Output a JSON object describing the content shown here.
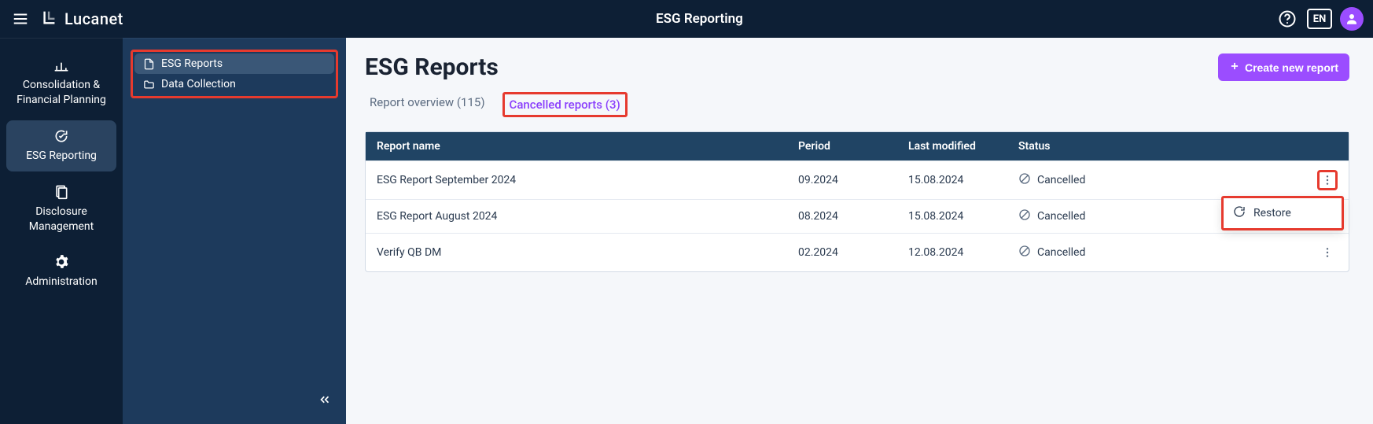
{
  "header": {
    "brand": "Lucanet",
    "title": "ESG Reporting",
    "lang": "EN"
  },
  "nav": {
    "items": [
      {
        "label": "Consolidation & Financial Planning"
      },
      {
        "label": "ESG Reporting"
      },
      {
        "label": "Disclosure Management"
      },
      {
        "label": "Administration"
      }
    ]
  },
  "sidebar": {
    "items": [
      {
        "label": "ESG Reports"
      },
      {
        "label": "Data Collection"
      }
    ]
  },
  "page": {
    "title": "ESG Reports",
    "create_label": "Create new report"
  },
  "tabs": {
    "overview": "Report overview (115)",
    "cancelled": "Cancelled reports (3)"
  },
  "table": {
    "headers": {
      "name": "Report name",
      "period": "Period",
      "modified": "Last modified",
      "status": "Status"
    },
    "rows": [
      {
        "name": "ESG Report September 2024",
        "period": "09.2024",
        "modified": "15.08.2024",
        "status": "Cancelled"
      },
      {
        "name": "ESG Report August 2024",
        "period": "08.2024",
        "modified": "15.08.2024",
        "status": "Cancelled"
      },
      {
        "name": "Verify QB DM",
        "period": "02.2024",
        "modified": "12.08.2024",
        "status": "Cancelled"
      }
    ]
  },
  "popover": {
    "restore": "Restore"
  }
}
